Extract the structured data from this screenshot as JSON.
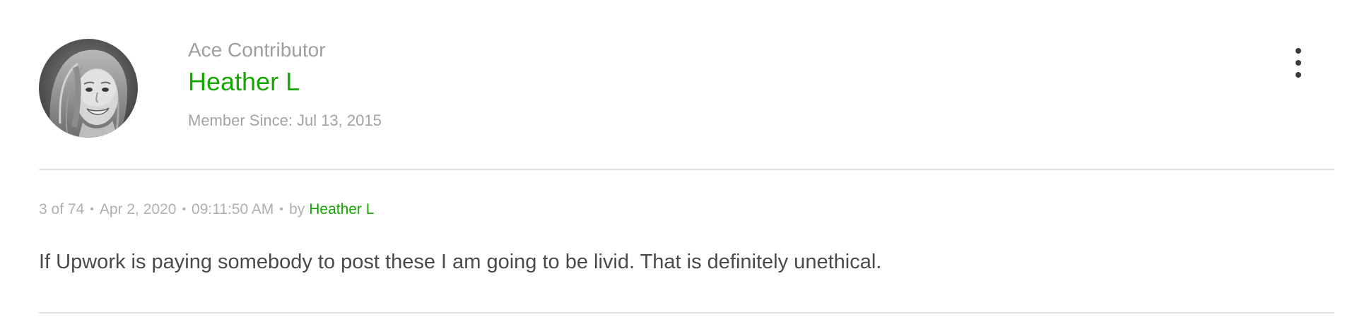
{
  "profile": {
    "rank": "Ace Contributor",
    "name": "Heather L",
    "member_since_label": "Member Since:",
    "member_since_date": "Jul 13, 2015"
  },
  "post": {
    "position": "3 of 74",
    "date": "Apr 2, 2020",
    "time": "09:11:50 AM",
    "by_label": "by",
    "author": "Heather L",
    "body": "If Upwork is paying somebody to post these I am going to be livid. That is definitely unethical."
  },
  "meta_separator": "•",
  "icons": {
    "menu": "more-vertical-icon"
  },
  "colors": {
    "accent": "#14a800",
    "muted_text": "#9e9e9e",
    "body_text": "#4a4a4a",
    "divider": "#e0e0e0"
  }
}
